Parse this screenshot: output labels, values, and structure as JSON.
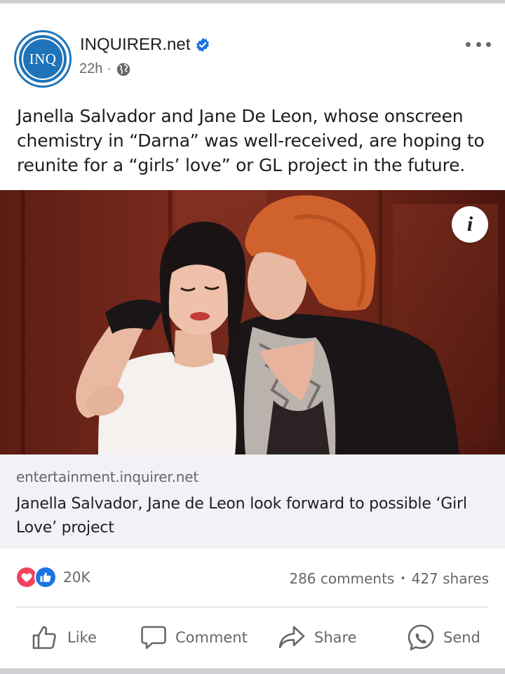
{
  "post": {
    "page_name": "INQUIRER.net",
    "avatar_text": "INQ",
    "time": "22h",
    "meta_separator": "·",
    "audience_icon": "globe-icon",
    "verified_icon": "verified-badge-icon",
    "more_icon": "more-options-icon",
    "caption": "Janella Salvador and Jane De Leon, whose onscreen chemistry in “Darna” was well-received, are hoping to reunite for a “girls’ love” or GL project in the future.",
    "photo_info_label": "i"
  },
  "link_preview": {
    "domain": "entertainment.inquirer.net",
    "title": "Janella Salvador, Jane de Leon look forward to possible ‘Girl Love’ project"
  },
  "engagement": {
    "reaction_count": "20K",
    "comments": "286 comments",
    "separator": "•",
    "shares": "427 shares"
  },
  "actions": {
    "like": "Like",
    "comment": "Comment",
    "share": "Share",
    "send": "Send"
  },
  "colors": {
    "brand_blue": "#1e73b9",
    "like_blue": "#1b74e4",
    "love_red": "#f3425f",
    "secondary_text": "#65676b",
    "link_bg": "#f0f2f5"
  }
}
